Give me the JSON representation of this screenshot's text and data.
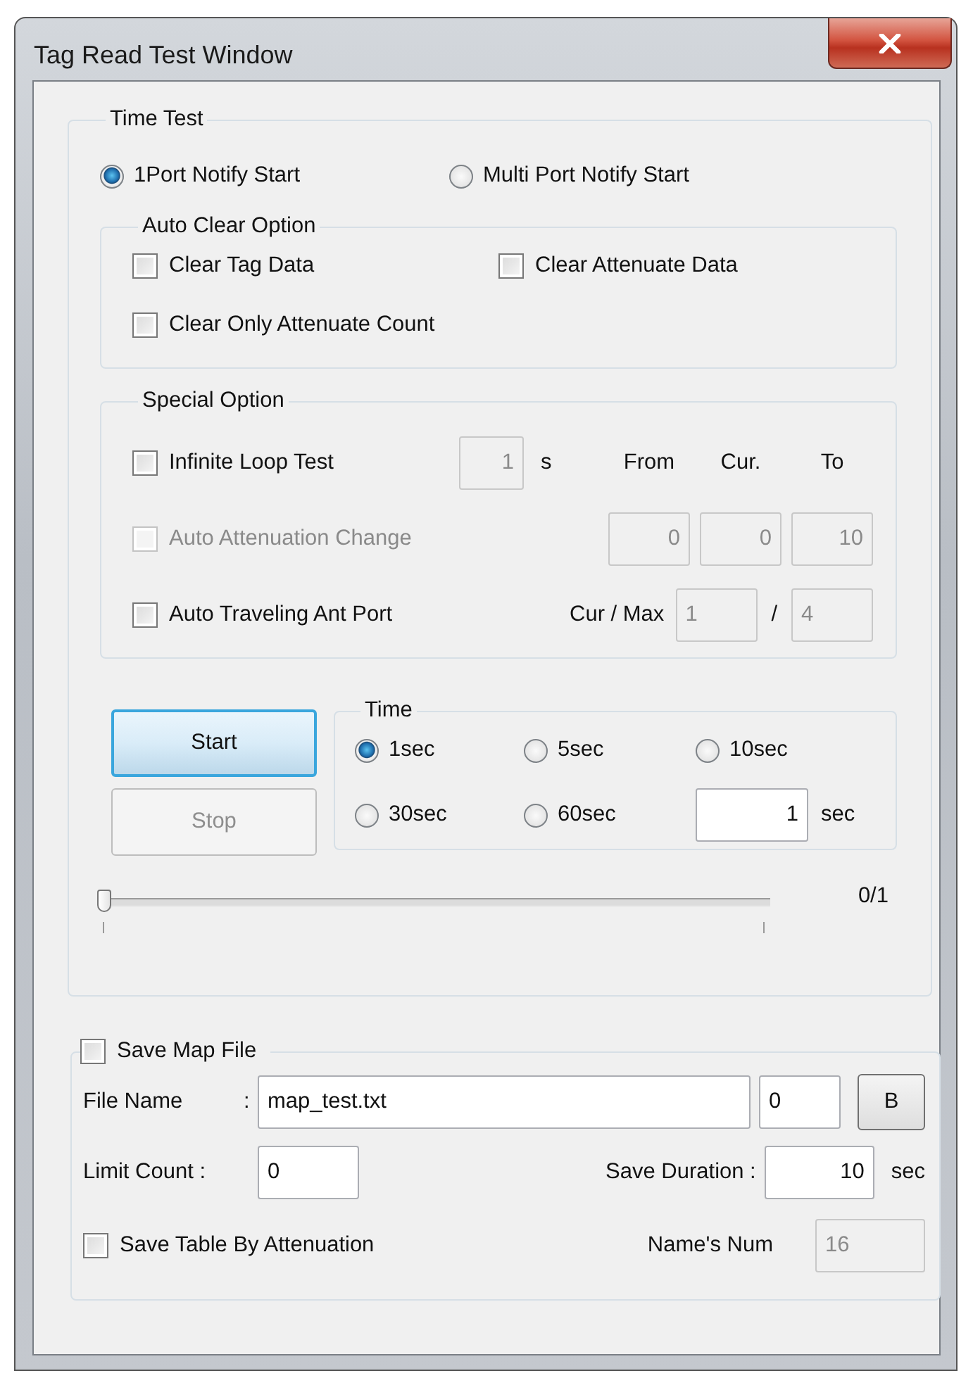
{
  "window": {
    "title": "Tag Read Test Window"
  },
  "time_test": {
    "title": "Time Test",
    "notify_options": [
      {
        "label": "1Port Notify Start",
        "selected": true
      },
      {
        "label": "Multi Port Notify Start",
        "selected": false
      }
    ],
    "auto_clear": {
      "title": "Auto Clear Option",
      "options": [
        {
          "label": "Clear Tag Data",
          "checked": false
        },
        {
          "label": "Clear Attenuate Data",
          "checked": false
        },
        {
          "label": "Clear Only Attenuate Count",
          "checked": false
        }
      ]
    },
    "special_option": {
      "title": "Special Option",
      "infinite_loop": {
        "label": "Infinite Loop Test",
        "checked": false,
        "field": {
          "value": "1",
          "disabled": true
        },
        "unit": "s"
      },
      "headers": [
        "From",
        "Cur.",
        "To"
      ],
      "auto_attenuation": {
        "label": "Auto Attenuation Change",
        "checked": false,
        "disabled": true,
        "fields": [
          {
            "value": "0",
            "disabled": true
          },
          {
            "value": "0",
            "disabled": true
          },
          {
            "value": "10",
            "disabled": true
          }
        ]
      },
      "auto_traveling": {
        "label": "Auto Traveling Ant Port",
        "checked": false,
        "cur_max_label": "Cur / Max",
        "cur": {
          "value": "1",
          "disabled": true
        },
        "separator": "/",
        "max": {
          "value": "4",
          "disabled": true
        }
      }
    },
    "buttons": [
      {
        "label": "Start",
        "disabled": false,
        "focused": true
      },
      {
        "label": "Stop",
        "disabled": true,
        "focused": false
      }
    ],
    "time": {
      "title": "Time",
      "options": [
        {
          "label": "1sec",
          "selected": true
        },
        {
          "label": "5sec",
          "selected": false
        },
        {
          "label": "10sec",
          "selected": false
        },
        {
          "label": "30sec",
          "selected": false
        },
        {
          "label": "60sec",
          "selected": false
        }
      ],
      "custom": {
        "value": "1",
        "disabled": false
      },
      "unit": "sec"
    },
    "progress": {
      "level": 0,
      "reading": "0/1"
    }
  },
  "save_map": {
    "label": "Save Map File",
    "checked": false,
    "file_name_label": "File Name",
    "colon": ":",
    "file_name": {
      "value": "map_test.txt",
      "disabled": false
    },
    "file_index": {
      "value": "0",
      "disabled": false
    },
    "browse_button": "B",
    "limit_count_label": "Limit Count :",
    "limit_count": {
      "value": "0",
      "disabled": false
    },
    "save_duration_label": "Save Duration :",
    "save_duration": {
      "value": "10",
      "disabled": false
    },
    "duration_unit": "sec",
    "save_table": {
      "label": "Save Table By Attenuation",
      "checked": false
    },
    "names_num_label": "Name's Num",
    "names_num": {
      "value": "16",
      "disabled": true
    }
  }
}
